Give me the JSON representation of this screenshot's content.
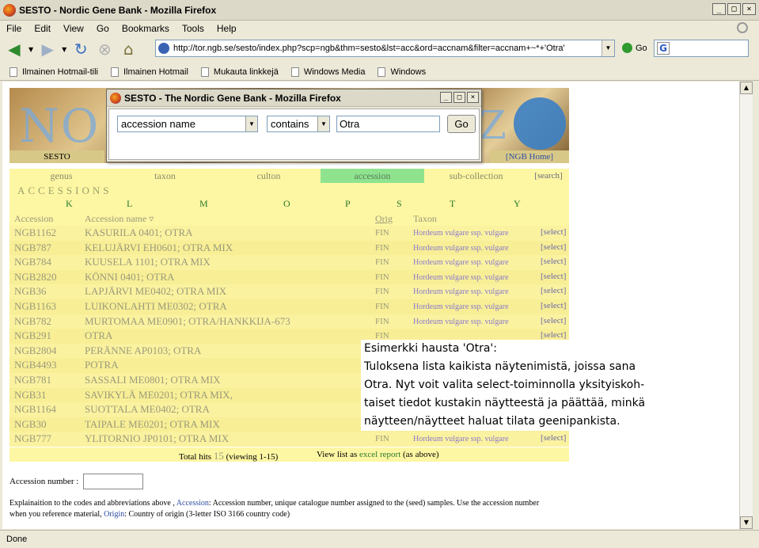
{
  "browser": {
    "title": "SESTO - Nordic Gene Bank - Mozilla Firefox",
    "window_buttons": [
      "_",
      "□",
      "×"
    ],
    "menu": [
      "File",
      "Edit",
      "View",
      "Go",
      "Bookmarks",
      "Tools",
      "Help"
    ],
    "url": "http://tor.ngb.se/sesto/index.php?scp=ngb&thm=sesto&lst=acc&ord=accnam&filter=accnam+~*+'Otra'",
    "go_label": "Go",
    "search_engine_icon": "G",
    "bookmarks": [
      "Ilmainen Hotmail-tili",
      "Ilmainen Hotmail",
      "Mukauta linkkejä",
      "Windows Media",
      "Windows"
    ],
    "status": "Done"
  },
  "popup": {
    "title": "SESTO - The Nordic Gene Bank - Mozilla Firefox",
    "field_select": "accession name",
    "operator_select": "contains",
    "search_value": "Otra",
    "go_label": "Go"
  },
  "page": {
    "banner_text": "NO",
    "banner_letter": "Z",
    "sesto_label": "SESTO",
    "ngb_home": "[NGB Home]",
    "tabs": [
      "genus",
      "taxon",
      "culton",
      "accession",
      "sub-collection",
      "[search]"
    ],
    "active_tab": "accession",
    "section_title": "ACCESSIONS",
    "letters": [
      "K",
      "L",
      "M",
      "O",
      "P",
      "S",
      "T",
      "Y"
    ],
    "columns": {
      "accession": "Accession",
      "name": "Accession name ▿",
      "orig": "Orig",
      "taxon": "Taxon"
    },
    "rows": [
      {
        "acc": "NGB1162",
        "name": "KASURILA 0401; OTRA",
        "orig": "FIN",
        "taxon": "Hordeum vulgare ssp. vulgare",
        "sel": "[select]"
      },
      {
        "acc": "NGB787",
        "name": "KELUJÄRVI EH0601; OTRA MIX",
        "orig": "FIN",
        "taxon": "Hordeum vulgare ssp. vulgare",
        "sel": "[select]"
      },
      {
        "acc": "NGB784",
        "name": "KUUSELA 1101; OTRA MIX",
        "orig": "FIN",
        "taxon": "Hordeum vulgare ssp. vulgare",
        "sel": "[select]"
      },
      {
        "acc": "NGB2820",
        "name": "KÖNNI 0401; OTRA",
        "orig": "FIN",
        "taxon": "Hordeum vulgare ssp. vulgare",
        "sel": "[select]"
      },
      {
        "acc": "NGB36",
        "name": "LAPJÄRVI ME0402; OTRA MIX",
        "orig": "FIN",
        "taxon": "Hordeum vulgare ssp. vulgare",
        "sel": "[select]"
      },
      {
        "acc": "NGB1163",
        "name": "LUIKONLAHTI ME0302; OTRA",
        "orig": "FIN",
        "taxon": "Hordeum vulgare ssp. vulgare",
        "sel": "[select]"
      },
      {
        "acc": "NGB782",
        "name": "MURTOMAA ME0901; OTRA/HANKKIJA-673",
        "orig": "FIN",
        "taxon": "Hordeum vulgare ssp. vulgare",
        "sel": "[select]"
      },
      {
        "acc": "NGB291",
        "name": "OTRA",
        "orig": "FIN",
        "taxon": "",
        "sel": "[select]"
      },
      {
        "acc": "NGB2804",
        "name": "PERÄNNE AP0103; OTRA",
        "orig": "",
        "taxon": "",
        "sel": ""
      },
      {
        "acc": "NGB4493",
        "name": "POTRA",
        "orig": "",
        "taxon": "",
        "sel": ""
      },
      {
        "acc": "NGB781",
        "name": "SASSALI ME0801; OTRA MIX",
        "orig": "",
        "taxon": "",
        "sel": ""
      },
      {
        "acc": "NGB31",
        "name": "SAVIKYLÄ ME0201; OTRA MIX,",
        "orig": "",
        "taxon": "",
        "sel": ""
      },
      {
        "acc": "NGB1164",
        "name": "SUOTTALA ME0402; OTRA",
        "orig": "",
        "taxon": "",
        "sel": ""
      },
      {
        "acc": "NGB30",
        "name": "TAIPALE ME0201; OTRA MIX",
        "orig": "",
        "taxon": "",
        "sel": ""
      },
      {
        "acc": "NGB777",
        "name": "YLITORNIO JP0101; OTRA MIX",
        "orig": "FIN",
        "taxon": "Hordeum vulgare ssp. vulgare",
        "sel": "[select]"
      }
    ],
    "totals_label": "Total hits",
    "totals_count": "15",
    "totals_viewing": "(viewing 1-15)",
    "view_list_prefix": "View list as",
    "view_list_link": "excel report",
    "view_list_suffix": "(as above)",
    "accession_number_label": "Accession number :",
    "explain_1": "Explainaition to the codes and abbreviations above ,",
    "explain_acc_link": "Accession",
    "explain_2": ": Accession number, unique catalogue number assigned to the (seed) samples. Use the accession number when you reference material,",
    "explain_origin_link": "Origin",
    "explain_3": ": Country of origin (3-letter ISO 3166 country code)"
  },
  "callout": {
    "line1": "Esimerkki hausta 'Otra':",
    "line2": "Tuloksena lista kaikista näytenimistä, joissa sana",
    "line3": "Otra. Nyt voit valita select-toiminnolla yksityiskoh-",
    "line4": "taiset tiedot kustakin näytteestä ja päättää, minkä",
    "line5": "näytteen/näytteet haluat tilata geenipankista."
  }
}
